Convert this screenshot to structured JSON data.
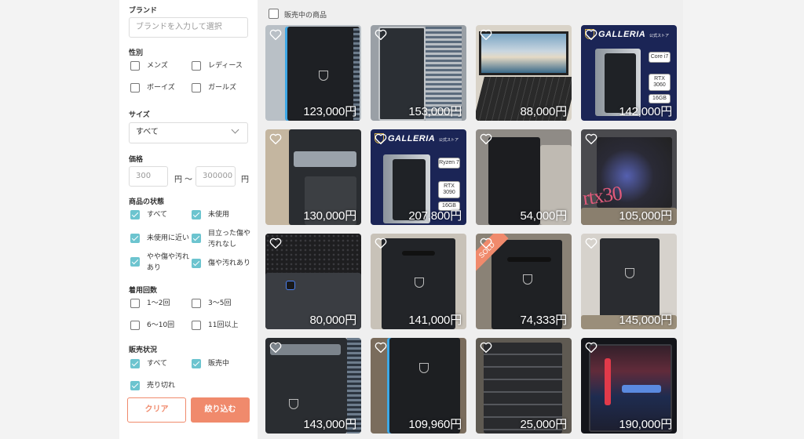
{
  "sidebar": {
    "brand": {
      "title": "ブランド",
      "placeholder": "ブランドを入力して選択"
    },
    "gender": {
      "title": "性別",
      "options": [
        "メンズ",
        "レディース",
        "ボーイズ",
        "ガールズ"
      ]
    },
    "size": {
      "title": "サイズ",
      "value": "すべて"
    },
    "price": {
      "title": "価格",
      "min": "300",
      "max": "300000",
      "unit": "円",
      "separator": "〜"
    },
    "condition": {
      "title": "商品の状態",
      "options": [
        "すべて",
        "未使用",
        "未使用に近い",
        "目立った傷や汚れなし",
        "やや傷や汚れあり",
        "傷や汚れあり"
      ]
    },
    "wear": {
      "title": "着用回数",
      "options": [
        "1〜2回",
        "3〜5回",
        "6〜10回",
        "11回以上"
      ]
    },
    "sales": {
      "title": "販売状況",
      "options": [
        "すべて",
        "販売中",
        "売り切れ"
      ]
    },
    "buttons": {
      "clear": "クリア",
      "apply": "絞り込む"
    }
  },
  "main": {
    "on_sale_only": "販売中の商品",
    "products": [
      {
        "price": "123,000円"
      },
      {
        "price": "153,000円"
      },
      {
        "price": "88,000円"
      },
      {
        "price": "142,000円",
        "brand": "GALLERIA",
        "store": "公式ストア",
        "specs": [
          "Core i7",
          "RTX 3060",
          "16GB"
        ]
      },
      {
        "price": "130,000円"
      },
      {
        "price": "207,800円",
        "brand": "GALLERIA",
        "store": "公式ストア",
        "specs": [
          "Ryzen 7",
          "RTX 3090",
          "16GB"
        ]
      },
      {
        "price": "54,000円"
      },
      {
        "price": "105,000円",
        "overlay": "rtx30"
      },
      {
        "price": "80,000円"
      },
      {
        "price": "141,000円"
      },
      {
        "price": "74,333円",
        "badge": "SOLD"
      },
      {
        "price": "145,000円"
      },
      {
        "price": "143,000円"
      },
      {
        "price": "109,960円"
      },
      {
        "price": "25,000円"
      },
      {
        "price": "190,000円"
      }
    ]
  },
  "colors": {
    "accent": "#f08a6c",
    "check": "#6cc4cf",
    "galleria_bg": "#1b2556"
  }
}
